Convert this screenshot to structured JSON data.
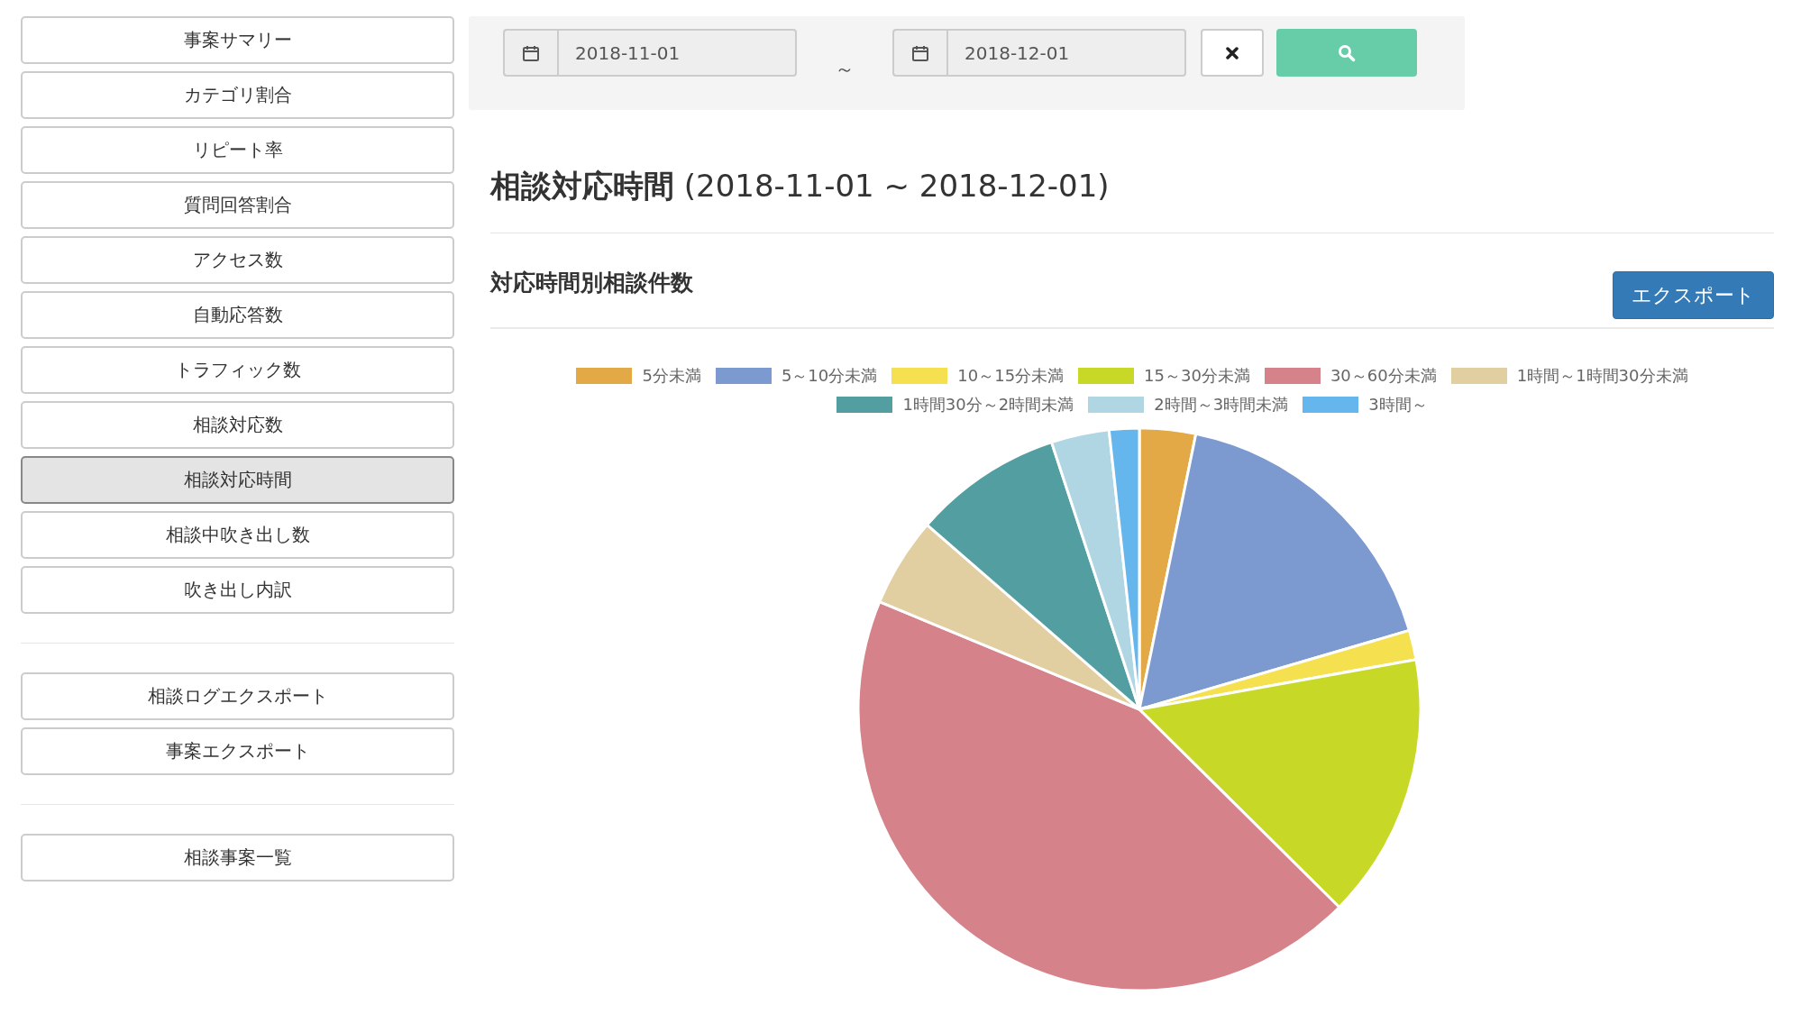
{
  "sidebar": {
    "groups": [
      {
        "items": [
          {
            "label": "事案サマリー",
            "selected": false
          },
          {
            "label": "カテゴリ割合",
            "selected": false
          },
          {
            "label": "リピート率",
            "selected": false
          },
          {
            "label": "質問回答割合",
            "selected": false
          },
          {
            "label": "アクセス数",
            "selected": false
          },
          {
            "label": "自動応答数",
            "selected": false
          },
          {
            "label": "トラフィック数",
            "selected": false
          },
          {
            "label": "相談対応数",
            "selected": false
          },
          {
            "label": "相談対応時間",
            "selected": true
          },
          {
            "label": "相談中吹き出し数",
            "selected": false
          },
          {
            "label": "吹き出し内訳",
            "selected": false
          }
        ]
      },
      {
        "items": [
          {
            "label": "相談ログエクスポート",
            "selected": false
          },
          {
            "label": "事案エクスポート",
            "selected": false
          }
        ]
      },
      {
        "items": [
          {
            "label": "相談事案一覧",
            "selected": false
          }
        ]
      }
    ]
  },
  "filter": {
    "start_date": "2018-11-01",
    "separator": "～",
    "end_date": "2018-12-01"
  },
  "title": {
    "main": "相談対応時間",
    "range": "(2018-11-01 ~ 2018-12-01)"
  },
  "section": {
    "heading": "対応時間別相談件数",
    "export_button": "エクスポート"
  },
  "legend": [
    {
      "label": "5分未満",
      "color": "#e3a946"
    },
    {
      "label": "5～10分未満",
      "color": "#7c9ad0"
    },
    {
      "label": "10～15分未満",
      "color": "#f5e050"
    },
    {
      "label": "15～30分未満",
      "color": "#c8d826"
    },
    {
      "label": "30～60分未満",
      "color": "#d5828a"
    },
    {
      "label": "1時間～1時間30分未満",
      "color": "#e1cfa2"
    },
    {
      "label": "1時間30分～2時間未満",
      "color": "#529ea0"
    },
    {
      "label": "2時間～3時間未満",
      "color": "#b0d6e3"
    },
    {
      "label": "3時間～",
      "color": "#64b6ec"
    }
  ]
}
